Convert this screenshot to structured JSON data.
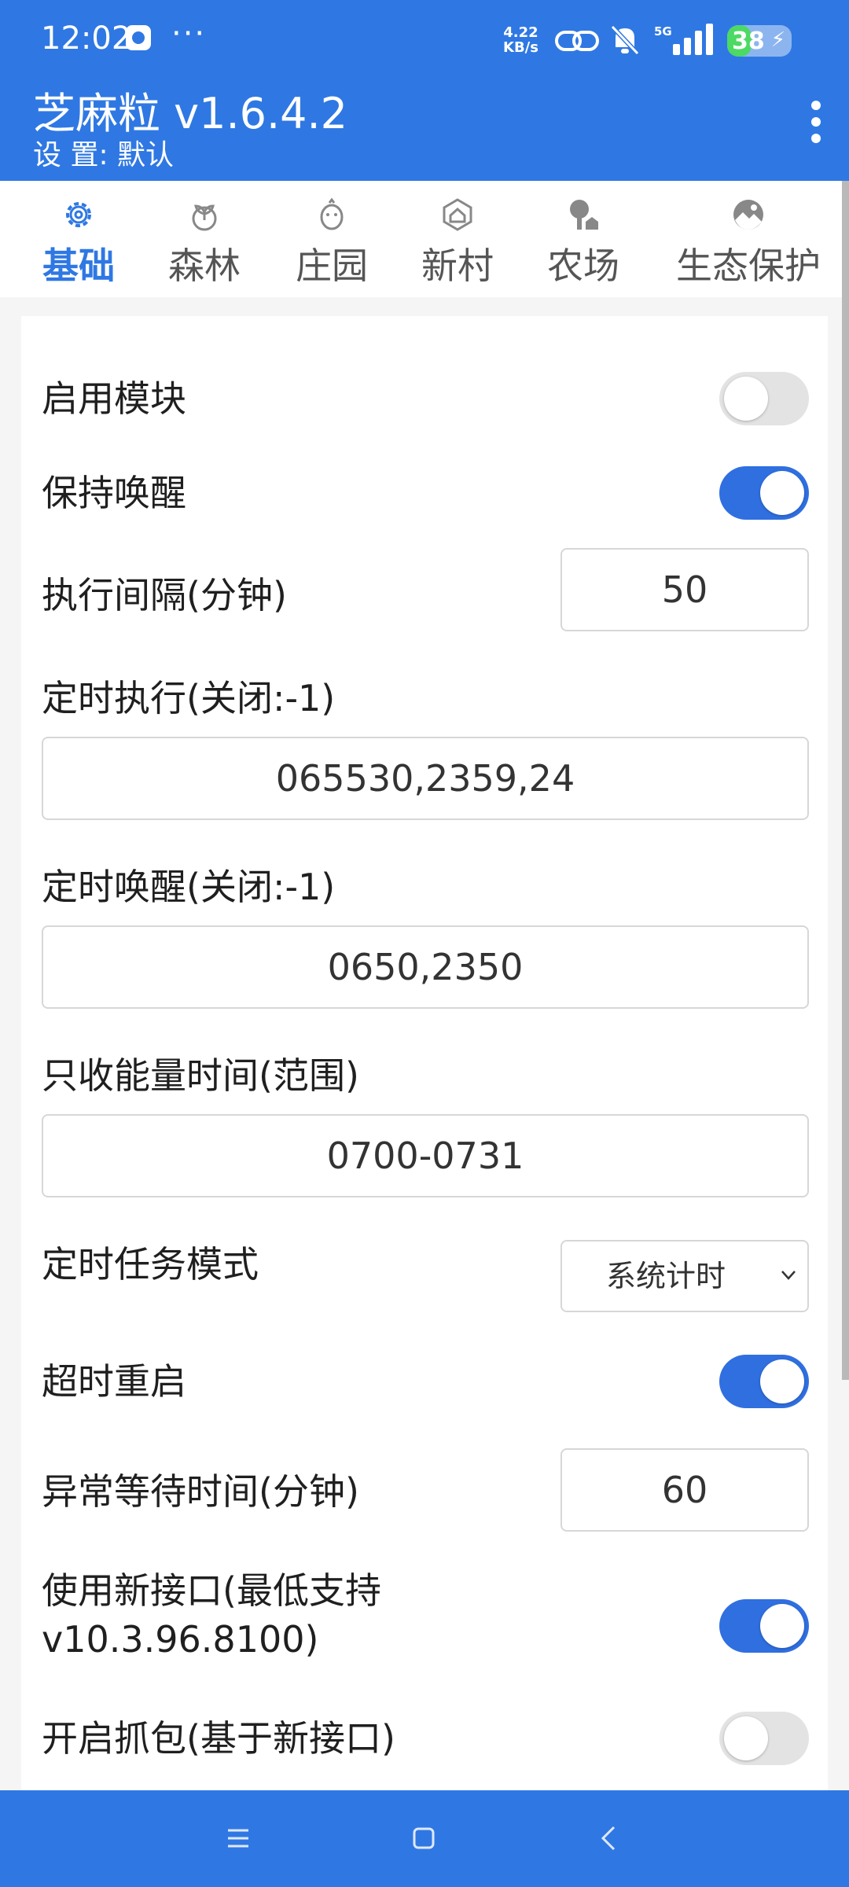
{
  "status_bar": {
    "time": "12:02",
    "dots": "···",
    "speed_value": "4.22",
    "speed_unit": "KB/s",
    "network": "5G",
    "battery": "38",
    "battery_level": 0.38
  },
  "app_bar": {
    "title": "芝麻粒 v1.6.4.2",
    "subtitle": "设 置: 默认"
  },
  "tabs": [
    {
      "label": "基础",
      "icon": "gear-icon",
      "active": true
    },
    {
      "label": "森林",
      "icon": "sprout-icon",
      "active": false
    },
    {
      "label": "庄园",
      "icon": "chick-icon",
      "active": false
    },
    {
      "label": "新村",
      "icon": "house-badge-icon",
      "active": false
    },
    {
      "label": "农场",
      "icon": "tree-house-icon",
      "active": false
    },
    {
      "label": "生态保护",
      "icon": "landscape-icon",
      "active": false
    }
  ],
  "settings": {
    "enable_module": {
      "label": "启用模块",
      "on": false
    },
    "keep_awake": {
      "label": "保持唤醒",
      "on": true
    },
    "exec_interval": {
      "label": "执行间隔(分钟)",
      "value": "50"
    },
    "scheduled_exec": {
      "label": "定时执行(关闭:-1)",
      "value": "065530,2359,24"
    },
    "scheduled_wake": {
      "label": "定时唤醒(关闭:-1)",
      "value": "0650,2350"
    },
    "energy_time": {
      "label": "只收能量时间(范围)",
      "value": "0700-0731"
    },
    "task_mode": {
      "label": "定时任务模式",
      "value": "系统计时"
    },
    "timeout_restart": {
      "label": "超时重启",
      "on": true
    },
    "error_wait": {
      "label": "异常等待时间(分钟)",
      "value": "60"
    },
    "new_api": {
      "label_line1": "使用新接口(最低支持",
      "label_line2": "v10.3.96.8100)",
      "on": true
    },
    "capture": {
      "label": "开启抓包(基于新接口)",
      "on": false
    }
  },
  "colors": {
    "primary": "#2f78e3",
    "toggle_on": "#2f6fe0",
    "toggle_off": "#e3e3e3"
  }
}
